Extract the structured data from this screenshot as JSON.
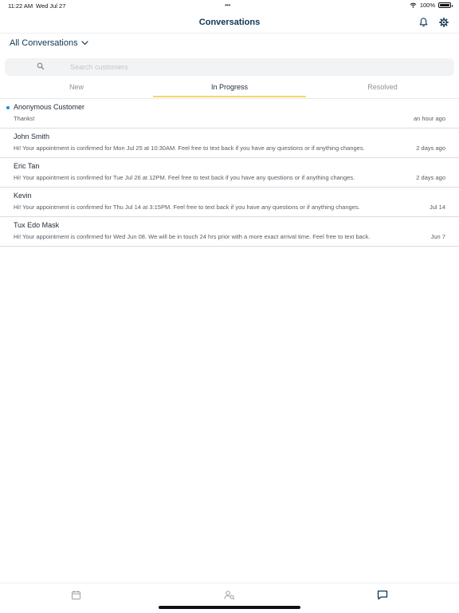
{
  "status_bar": {
    "time": "11:22 AM",
    "date": "Wed Jul 27",
    "dots": "•••",
    "battery": "100%"
  },
  "header": {
    "title": "Conversations"
  },
  "filter": {
    "label": "All Conversations"
  },
  "search": {
    "placeholder": "Search customers"
  },
  "tabs": [
    {
      "label": "New"
    },
    {
      "label": "In Progress",
      "active": true
    },
    {
      "label": "Resolved"
    }
  ],
  "conversations": [
    {
      "name": "Anonymous Customer",
      "preview": "Thanks!",
      "time": "an hour ago",
      "unread": true
    },
    {
      "name": "John Smith",
      "preview": "Hi! Your appointment is confirmed for Mon Jul 25 at 10:30AM. Feel free to text back if you have any questions or if anything changes.",
      "time": "2 days ago"
    },
    {
      "name": "Eric Tan",
      "preview": "Hi! Your appointment is confirmed for Tue Jul 26 at 12PM. Feel free to text back if you have any questions or if anything changes.",
      "time": "2 days ago"
    },
    {
      "name": "Kevin",
      "preview": "Hi! Your appointment is confirmed for Thu Jul 14 at 3:15PM. Feel free to text back if you have any questions or if anything changes.",
      "time": "Jul 14"
    },
    {
      "name": "Tux Edo Mask",
      "preview": "Hi! Your appointment is confirmed for Wed Jun 08. We will be in touch 24 hrs prior with a more exact arrival time. Feel free to text back.",
      "time": "Jun 7"
    }
  ],
  "icons": {
    "notification": "bell-icon",
    "settings": "gear-icon",
    "search": "search-icon",
    "calendar": "calendar-icon",
    "customers": "customer-search-icon",
    "messages": "chat-icon"
  },
  "colors": {
    "accent": "#0f3552",
    "tab_underline": "#f2d76b",
    "unread_dot": "#1f8ed6"
  }
}
